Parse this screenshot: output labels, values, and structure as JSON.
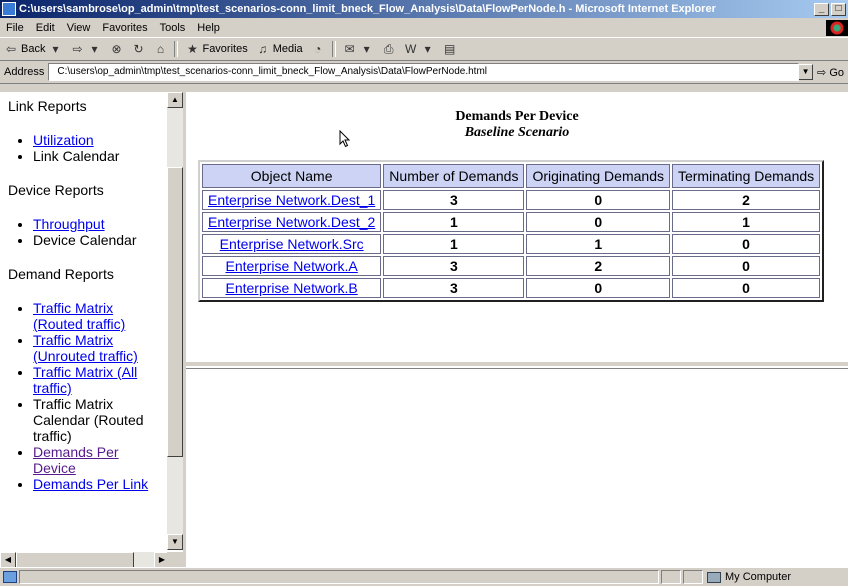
{
  "window": {
    "title": "C:\\users\\sambrose\\op_admin\\tmp\\test_scenarios-conn_limit_bneck_Flow_Analysis\\Data\\FlowPerNode.h - Microsoft Internet Explorer"
  },
  "menu": [
    "File",
    "Edit",
    "View",
    "Favorites",
    "Tools",
    "Help"
  ],
  "toolbar": {
    "back": "Back",
    "favorites": "Favorites",
    "media": "Media"
  },
  "address": {
    "label": "Address",
    "value": "C:\\users\\op_admin\\tmp\\test_scenarios-conn_limit_bneck_Flow_Analysis\\Data\\FlowPerNode.html",
    "go": "Go"
  },
  "nav": {
    "link_reports": {
      "heading": "Link Reports",
      "utilization": "Utilization",
      "link_calendar": "Link Calendar"
    },
    "device_reports": {
      "heading": "Device Reports",
      "throughput": "Throughput",
      "device_calendar": "Device Calendar"
    },
    "demand_reports": {
      "heading": "Demand Reports",
      "tm_routed": "Traffic Matrix (Routed traffic)",
      "tm_unrouted": "Traffic Matrix (Unrouted traffic)",
      "tm_all": "Traffic Matrix (All traffic)",
      "tm_calendar": "Traffic Matrix Calendar (Routed traffic)",
      "demands_per_device": "Demands Per Device",
      "demands_per_link": "Demands Per Link"
    }
  },
  "report": {
    "title": "Demands Per Device",
    "subtitle": "Baseline Scenario",
    "columns": [
      "Object Name",
      "Number of Demands",
      "Originating Demands",
      "Terminating Demands"
    ],
    "rows": [
      {
        "name": "Enterprise Network.Dest_1",
        "number": "3",
        "originating": "0",
        "terminating": "2"
      },
      {
        "name": "Enterprise Network.Dest_2",
        "number": "1",
        "originating": "0",
        "terminating": "1"
      },
      {
        "name": "Enterprise Network.Src",
        "number": "1",
        "originating": "1",
        "terminating": "0"
      },
      {
        "name": "Enterprise Network.A",
        "number": "3",
        "originating": "2",
        "terminating": "0"
      },
      {
        "name": "Enterprise Network.B",
        "number": "3",
        "originating": "0",
        "terminating": "0"
      }
    ]
  },
  "status": {
    "zone": "My Computer"
  }
}
